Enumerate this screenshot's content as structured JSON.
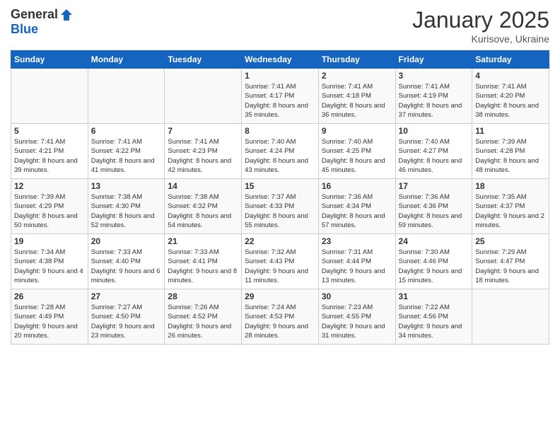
{
  "header": {
    "logo_general": "General",
    "logo_blue": "Blue",
    "month_title": "January 2025",
    "location": "Kurisove, Ukraine"
  },
  "days_of_week": [
    "Sunday",
    "Monday",
    "Tuesday",
    "Wednesday",
    "Thursday",
    "Friday",
    "Saturday"
  ],
  "weeks": [
    [
      {
        "day": "",
        "detail": ""
      },
      {
        "day": "",
        "detail": ""
      },
      {
        "day": "",
        "detail": ""
      },
      {
        "day": "1",
        "detail": "Sunrise: 7:41 AM\nSunset: 4:17 PM\nDaylight: 8 hours\nand 35 minutes."
      },
      {
        "day": "2",
        "detail": "Sunrise: 7:41 AM\nSunset: 4:18 PM\nDaylight: 8 hours\nand 36 minutes."
      },
      {
        "day": "3",
        "detail": "Sunrise: 7:41 AM\nSunset: 4:19 PM\nDaylight: 8 hours\nand 37 minutes."
      },
      {
        "day": "4",
        "detail": "Sunrise: 7:41 AM\nSunset: 4:20 PM\nDaylight: 8 hours\nand 38 minutes."
      }
    ],
    [
      {
        "day": "5",
        "detail": "Sunrise: 7:41 AM\nSunset: 4:21 PM\nDaylight: 8 hours\nand 39 minutes."
      },
      {
        "day": "6",
        "detail": "Sunrise: 7:41 AM\nSunset: 4:22 PM\nDaylight: 8 hours\nand 41 minutes."
      },
      {
        "day": "7",
        "detail": "Sunrise: 7:41 AM\nSunset: 4:23 PM\nDaylight: 8 hours\nand 42 minutes."
      },
      {
        "day": "8",
        "detail": "Sunrise: 7:40 AM\nSunset: 4:24 PM\nDaylight: 8 hours\nand 43 minutes."
      },
      {
        "day": "9",
        "detail": "Sunrise: 7:40 AM\nSunset: 4:25 PM\nDaylight: 8 hours\nand 45 minutes."
      },
      {
        "day": "10",
        "detail": "Sunrise: 7:40 AM\nSunset: 4:27 PM\nDaylight: 8 hours\nand 46 minutes."
      },
      {
        "day": "11",
        "detail": "Sunrise: 7:39 AM\nSunset: 4:28 PM\nDaylight: 8 hours\nand 48 minutes."
      }
    ],
    [
      {
        "day": "12",
        "detail": "Sunrise: 7:39 AM\nSunset: 4:29 PM\nDaylight: 8 hours\nand 50 minutes."
      },
      {
        "day": "13",
        "detail": "Sunrise: 7:38 AM\nSunset: 4:30 PM\nDaylight: 8 hours\nand 52 minutes."
      },
      {
        "day": "14",
        "detail": "Sunrise: 7:38 AM\nSunset: 4:32 PM\nDaylight: 8 hours\nand 54 minutes."
      },
      {
        "day": "15",
        "detail": "Sunrise: 7:37 AM\nSunset: 4:33 PM\nDaylight: 8 hours\nand 55 minutes."
      },
      {
        "day": "16",
        "detail": "Sunrise: 7:36 AM\nSunset: 4:34 PM\nDaylight: 8 hours\nand 57 minutes."
      },
      {
        "day": "17",
        "detail": "Sunrise: 7:36 AM\nSunset: 4:36 PM\nDaylight: 8 hours\nand 59 minutes."
      },
      {
        "day": "18",
        "detail": "Sunrise: 7:35 AM\nSunset: 4:37 PM\nDaylight: 9 hours\nand 2 minutes."
      }
    ],
    [
      {
        "day": "19",
        "detail": "Sunrise: 7:34 AM\nSunset: 4:38 PM\nDaylight: 9 hours\nand 4 minutes."
      },
      {
        "day": "20",
        "detail": "Sunrise: 7:33 AM\nSunset: 4:40 PM\nDaylight: 9 hours\nand 6 minutes."
      },
      {
        "day": "21",
        "detail": "Sunrise: 7:33 AM\nSunset: 4:41 PM\nDaylight: 9 hours\nand 8 minutes."
      },
      {
        "day": "22",
        "detail": "Sunrise: 7:32 AM\nSunset: 4:43 PM\nDaylight: 9 hours\nand 11 minutes."
      },
      {
        "day": "23",
        "detail": "Sunrise: 7:31 AM\nSunset: 4:44 PM\nDaylight: 9 hours\nand 13 minutes."
      },
      {
        "day": "24",
        "detail": "Sunrise: 7:30 AM\nSunset: 4:46 PM\nDaylight: 9 hours\nand 15 minutes."
      },
      {
        "day": "25",
        "detail": "Sunrise: 7:29 AM\nSunset: 4:47 PM\nDaylight: 9 hours\nand 18 minutes."
      }
    ],
    [
      {
        "day": "26",
        "detail": "Sunrise: 7:28 AM\nSunset: 4:49 PM\nDaylight: 9 hours\nand 20 minutes."
      },
      {
        "day": "27",
        "detail": "Sunrise: 7:27 AM\nSunset: 4:50 PM\nDaylight: 9 hours\nand 23 minutes."
      },
      {
        "day": "28",
        "detail": "Sunrise: 7:26 AM\nSunset: 4:52 PM\nDaylight: 9 hours\nand 26 minutes."
      },
      {
        "day": "29",
        "detail": "Sunrise: 7:24 AM\nSunset: 4:53 PM\nDaylight: 9 hours\nand 28 minutes."
      },
      {
        "day": "30",
        "detail": "Sunrise: 7:23 AM\nSunset: 4:55 PM\nDaylight: 9 hours\nand 31 minutes."
      },
      {
        "day": "31",
        "detail": "Sunrise: 7:22 AM\nSunset: 4:56 PM\nDaylight: 9 hours\nand 34 minutes."
      },
      {
        "day": "",
        "detail": ""
      }
    ]
  ]
}
